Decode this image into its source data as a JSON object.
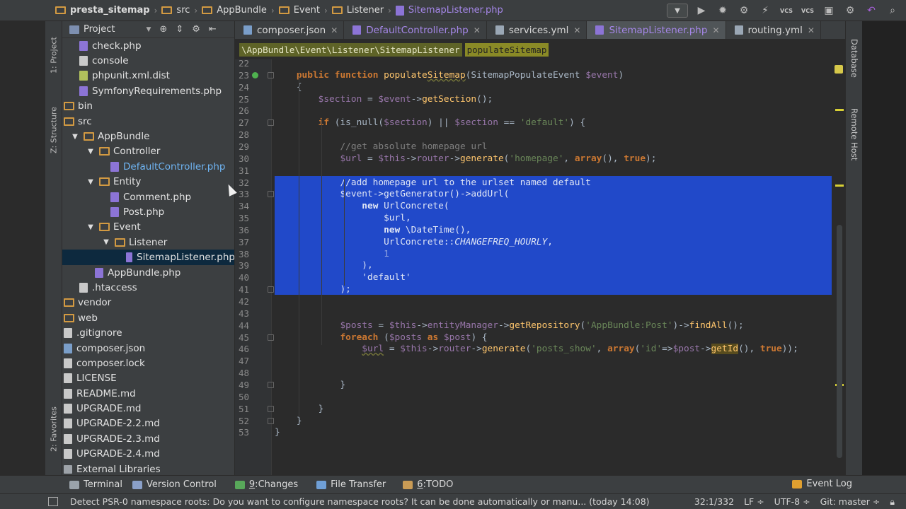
{
  "breadcrumbs": [
    "presta_sitemap",
    "src",
    "AppBundle",
    "Event",
    "Listener",
    "SitemapListener.php"
  ],
  "toolbar": {
    "vcs1": "VCS",
    "vcs2": "VCS"
  },
  "left_tabs": {
    "project": "1: Project",
    "structure": "Z: Structure",
    "favorites": "2: Favorites"
  },
  "project_panel": {
    "title": "Project",
    "tree": [
      {
        "label": "check.php",
        "icon": "php",
        "indent": 1
      },
      {
        "label": "console",
        "icon": "txt",
        "indent": 1
      },
      {
        "label": "phpunit.xml.dist",
        "icon": "xml",
        "indent": 1
      },
      {
        "label": "SymfonyRequirements.php",
        "icon": "php",
        "indent": 1
      },
      {
        "label": "bin",
        "icon": "folder",
        "indent": 0
      },
      {
        "label": "src",
        "icon": "folder",
        "indent": 0
      },
      {
        "label": "AppBundle",
        "icon": "folder",
        "indent": 1,
        "arrow": "▼"
      },
      {
        "label": "Controller",
        "icon": "folder",
        "indent": 2,
        "arrow": "▼"
      },
      {
        "label": "DefaultController.php",
        "icon": "php",
        "indent": 3,
        "blue": true
      },
      {
        "label": "Entity",
        "icon": "folder",
        "indent": 2,
        "arrow": "▼"
      },
      {
        "label": "Comment.php",
        "icon": "php",
        "indent": 3
      },
      {
        "label": "Post.php",
        "icon": "php",
        "indent": 3
      },
      {
        "label": "Event",
        "icon": "folder",
        "indent": 2,
        "arrow": "▼"
      },
      {
        "label": "Listener",
        "icon": "folder",
        "indent": 3,
        "arrow": "▼"
      },
      {
        "label": "SitemapListener.php",
        "icon": "php",
        "indent": 4,
        "selected": true
      },
      {
        "label": "AppBundle.php",
        "icon": "php",
        "indent": 2
      },
      {
        "label": ".htaccess",
        "icon": "txt",
        "indent": 1
      },
      {
        "label": "vendor",
        "icon": "folder",
        "indent": 0
      },
      {
        "label": "web",
        "icon": "folder",
        "indent": 0
      },
      {
        "label": ".gitignore",
        "icon": "txt",
        "indent": 0
      },
      {
        "label": "composer.json",
        "icon": "json",
        "indent": 0
      },
      {
        "label": "composer.lock",
        "icon": "txt",
        "indent": 0
      },
      {
        "label": "LICENSE",
        "icon": "txt",
        "indent": 0
      },
      {
        "label": "README.md",
        "icon": "txt",
        "indent": 0
      },
      {
        "label": "UPGRADE.md",
        "icon": "txt",
        "indent": 0
      },
      {
        "label": "UPGRADE-2.2.md",
        "icon": "txt",
        "indent": 0
      },
      {
        "label": "UPGRADE-2.3.md",
        "icon": "txt",
        "indent": 0
      },
      {
        "label": "UPGRADE-2.4.md",
        "icon": "txt",
        "indent": 0
      },
      {
        "label": "External Libraries",
        "icon": "lib",
        "indent": 0
      }
    ]
  },
  "tabs": [
    {
      "label": "composer.json",
      "icon": "json"
    },
    {
      "label": "DefaultController.php",
      "icon": "php"
    },
    {
      "label": "services.yml",
      "icon": "yml"
    },
    {
      "label": "SitemapListener.php",
      "icon": "php",
      "active": true
    },
    {
      "label": "routing.yml",
      "icon": "yml"
    }
  ],
  "editor_breadcrumb": {
    "namespace": "\\AppBundle\\Event\\Listener\\SitemapListener",
    "method": "populateSitemap"
  },
  "code_lines": [
    {
      "n": "22",
      "html": ""
    },
    {
      "n": "23",
      "html": "    <span class='kw'>public function</span> <span class='fn'>populate<span class='underline'>Sitemap</span></span><span class='plain'>(SitemapPopulateEvent </span><span class='var'>$event</span><span class='plain'>)</span>"
    },
    {
      "n": "24",
      "html": "    <span class='plain'>{</span>"
    },
    {
      "n": "25",
      "html": "        <span class='var'>$section</span><span class='plain'> = </span><span class='var'>$event</span><span class='plain'>-></span><span class='fn'>getSection</span><span class='plain'>();</span>"
    },
    {
      "n": "26",
      "html": ""
    },
    {
      "n": "27",
      "html": "        <span class='kw'>if</span><span class='plain'> (is_null(</span><span class='var'>$section</span><span class='plain'>) || </span><span class='var'>$section</span><span class='plain'> == </span><span class='str'>'default'</span><span class='plain'>) {</span>"
    },
    {
      "n": "28",
      "html": ""
    },
    {
      "n": "29",
      "html": "            <span class='cmt'>//get absolute homepage url</span>"
    },
    {
      "n": "30",
      "html": "            <span class='var'>$url</span><span class='plain'> = </span><span class='var'>$this</span><span class='plain'>-></span><span class='var'>router</span><span class='plain'>-></span><span class='fn'>generate</span><span class='plain'>(</span><span class='str'>'homepage'</span><span class='plain'>, </span><span class='kw'>array</span><span class='plain'>(), </span><span class='kw'>true</span><span class='plain'>);</span>"
    },
    {
      "n": "31",
      "html": ""
    },
    {
      "n": "32",
      "html": "            <span class='cmt'>//add homepage url to the urlset named default</span>",
      "sel": true
    },
    {
      "n": "33",
      "html": "            <span class='var'>$event</span><span class='plain'>-></span><span class='fn'>getGenerator</span><span class='plain'>()-></span><span class='fn'>addUrl</span><span class='plain'>(</span>",
      "sel": true
    },
    {
      "n": "34",
      "html": "                <span class='kw'>new</span><span class='plain'> UrlConcrete(</span>",
      "sel": true
    },
    {
      "n": "35",
      "html": "                    <span class='var'>$url</span><span class='plain'>,</span>",
      "sel": true
    },
    {
      "n": "36",
      "html": "                    <span class='kw'>new</span><span class='plain'> \\DateTime(),</span>",
      "sel": true
    },
    {
      "n": "37",
      "html": "                    <span class='plain'>UrlConcrete::</span><span class='italic-const'>CHANGEFREQ_HOURLY</span><span class='plain'>,</span>",
      "sel": true
    },
    {
      "n": "38",
      "html": "                    <span class='dimnum'>1</span>",
      "sel": true
    },
    {
      "n": "39",
      "html": "                <span class='plain'>),</span>",
      "sel": true
    },
    {
      "n": "40",
      "html": "                <span class='str'>'default'</span>",
      "sel": true
    },
    {
      "n": "41",
      "html": "            <span class='plain'>);</span>",
      "sel": true
    },
    {
      "n": "42",
      "html": ""
    },
    {
      "n": "43",
      "html": ""
    },
    {
      "n": "44",
      "html": "            <span class='var'>$posts</span><span class='plain'> = </span><span class='var'>$this</span><span class='plain'>-></span><span class='var'>entityManager</span><span class='plain'>-></span><span class='fn'>getRepository</span><span class='plain'>(</span><span class='str'>'AppBundle:Post'</span><span class='plain'>)-></span><span class='fn'>findAll</span><span class='plain'>();</span>"
    },
    {
      "n": "45",
      "html": "            <span class='kw'>foreach</span><span class='plain'> (</span><span class='var'>$posts</span><span class='plain'> </span><span class='kw'>as</span><span class='plain'> </span><span class='var'>$post</span><span class='plain'>) {</span>"
    },
    {
      "n": "46",
      "html": "                <span class='var underline'>$url</span><span class='plain'> = </span><span class='var'>$this</span><span class='plain'>-></span><span class='var'>router</span><span class='plain'>-></span><span class='fn'>generate</span><span class='plain'>(</span><span class='str'>'posts_show'</span><span class='plain'>, </span><span class='kw'>array</span><span class='plain'>(</span><span class='str'>'id'</span><span class='plain'>=></span><span class='var'>$post</span><span class='plain'>-></span><span class='hl-getid'>getId</span><span class='plain'>(), </span><span class='kw'>true</span><span class='plain'>));</span>"
    },
    {
      "n": "47",
      "html": ""
    },
    {
      "n": "48",
      "html": ""
    },
    {
      "n": "49",
      "html": "            <span class='plain'>}</span>"
    },
    {
      "n": "50",
      "html": ""
    },
    {
      "n": "51",
      "html": "        <span class='plain'>}</span>"
    },
    {
      "n": "52",
      "html": "    <span class='plain'>}</span>"
    },
    {
      "n": "53",
      "html": "<span class='plain'>}</span>"
    }
  ],
  "right_tabs": {
    "database": "Database",
    "remote": "Remote Host"
  },
  "bottom_tools": [
    {
      "label": "Terminal",
      "key": ""
    },
    {
      "label": "Version Control",
      "key": ""
    },
    {
      "label": "Changes",
      "key": "9"
    },
    {
      "label": "File Transfer",
      "key": ""
    },
    {
      "label": "TODO",
      "key": "6"
    }
  ],
  "event_log": "Event Log",
  "status": {
    "message": "Detect PSR-0 namespace roots: Do you want to configure namespace roots? It can be done automatically or manu... (today 14:08)",
    "position": "32:1/332",
    "line_sep": "LF ÷",
    "encoding": "UTF-8 ÷",
    "git": "Git: master ÷"
  },
  "colors": {
    "selection": "#2149c9",
    "folder": "#d39a42",
    "php": "#8c74d6"
  }
}
